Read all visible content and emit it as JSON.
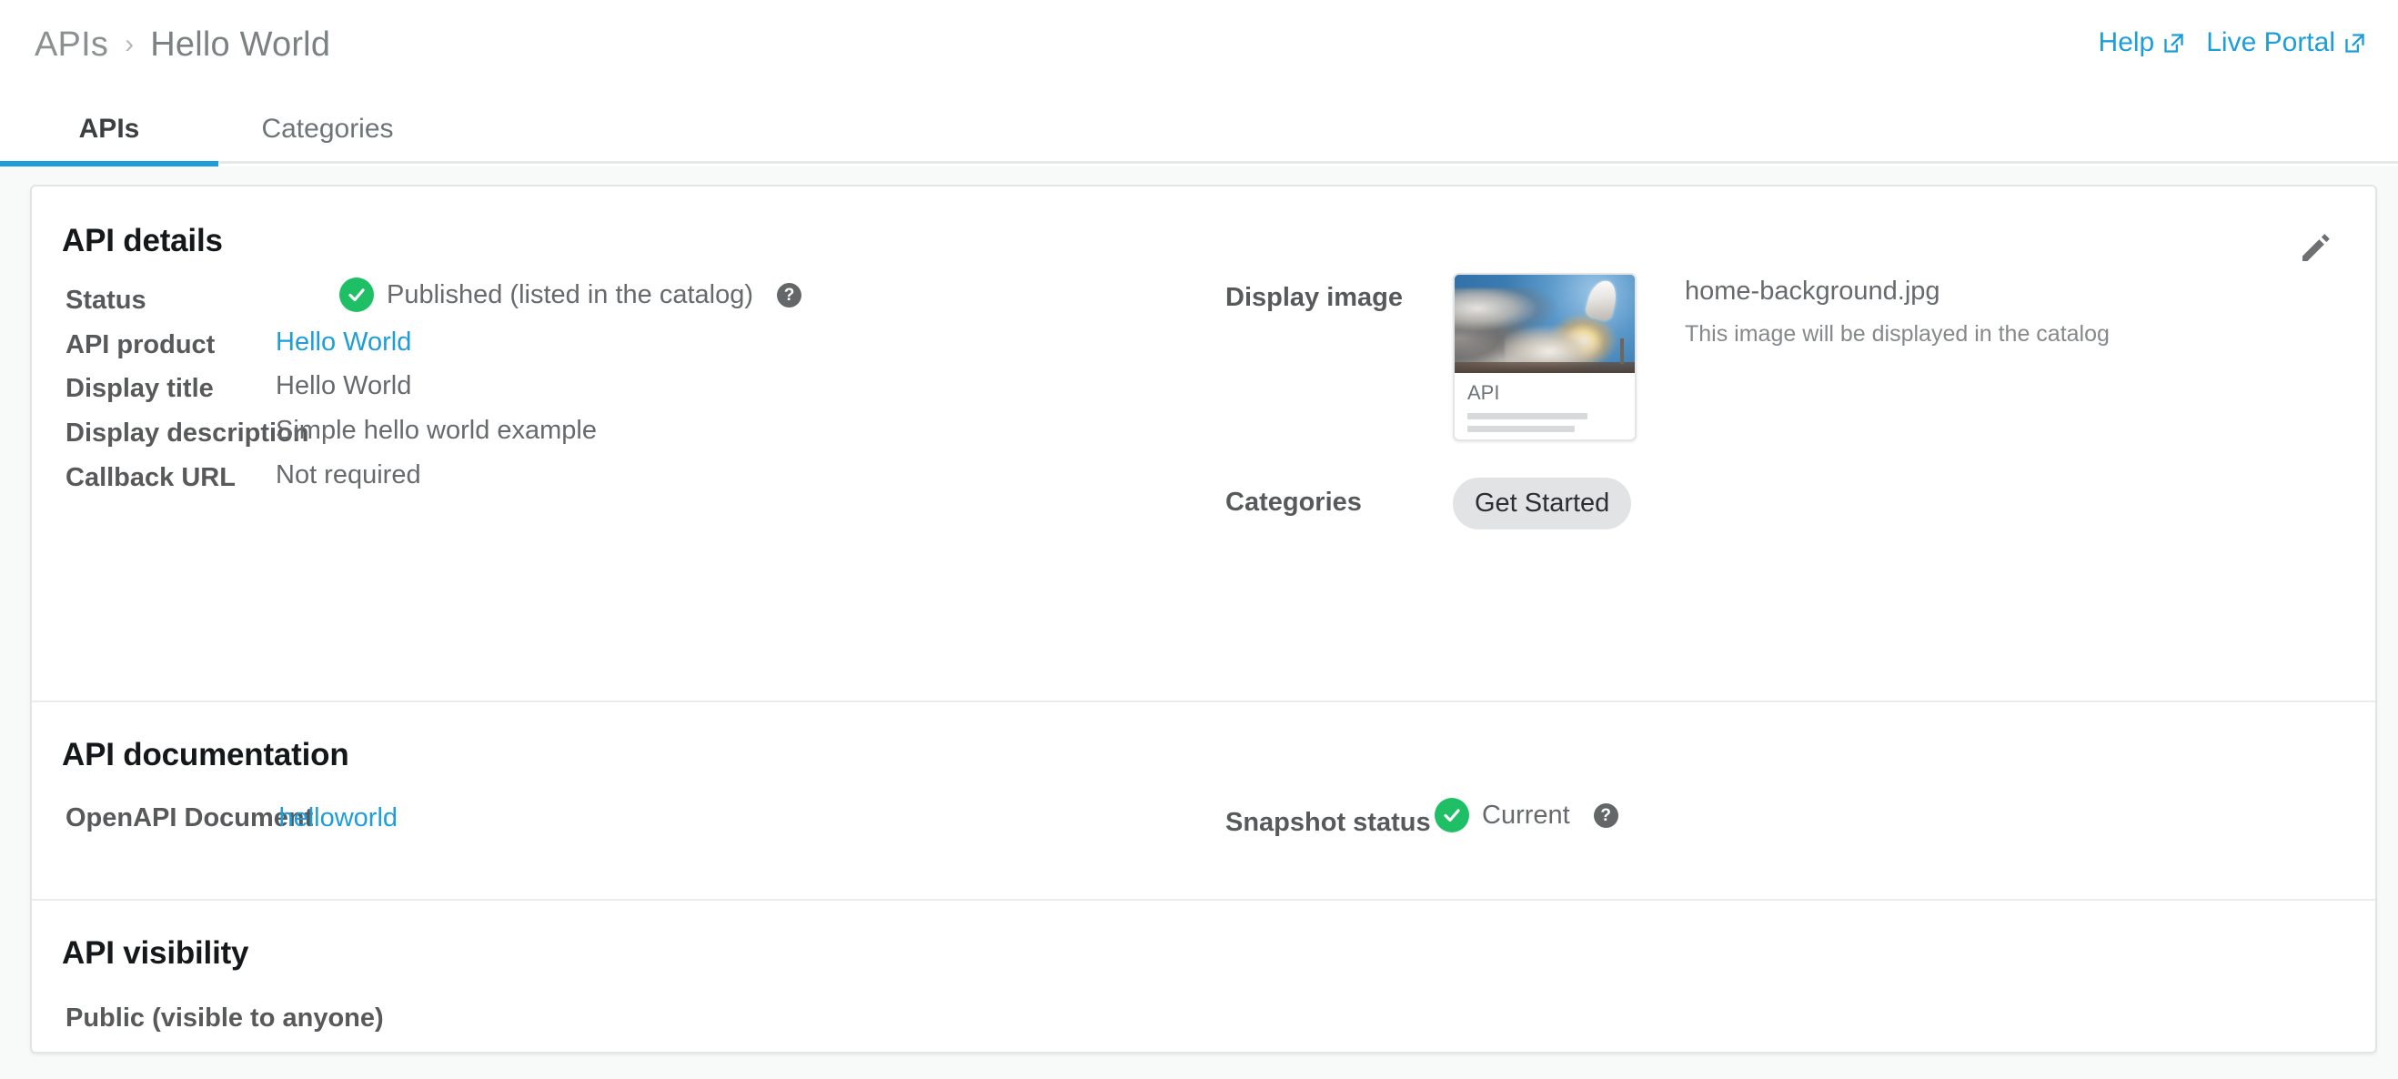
{
  "header": {
    "breadcrumb": {
      "root": "APIs",
      "separator": "›",
      "current": "Hello World"
    },
    "links": [
      {
        "label": "Help",
        "icon": "external-link-icon"
      },
      {
        "label": "Live Portal",
        "icon": "external-link-icon"
      }
    ]
  },
  "tabs": [
    {
      "label": "APIs",
      "active": true
    },
    {
      "label": "Categories",
      "active": false
    }
  ],
  "api_details": {
    "title": "API details",
    "edit_icon": "pencil-icon",
    "status": {
      "label": "Status",
      "value": "Published (listed in the catalog)",
      "icon": "check-circle-icon",
      "help_icon": "question-mark-icon",
      "help_glyph": "?"
    },
    "api_product": {
      "label": "API product",
      "value": "Hello World"
    },
    "display_title": {
      "label": "Display title",
      "value": "Hello World"
    },
    "display_description": {
      "label": "Display description",
      "value": "Simple hello world example"
    },
    "callback_url": {
      "label": "Callback URL",
      "value": "Not required"
    },
    "display_image": {
      "label": "Display image",
      "file_name": "home-background.jpg",
      "hint": "This image will be displayed in the catalog",
      "thumbnail_title": "API",
      "thumbnail_alt": "rocket-launch-photo"
    },
    "categories": {
      "label": "Categories",
      "chips": [
        "Get Started"
      ]
    }
  },
  "api_documentation": {
    "title": "API documentation",
    "openapi_document": {
      "label": "OpenAPI Document",
      "value": "helloworld"
    },
    "snapshot_status": {
      "label": "Snapshot status",
      "value": "Current",
      "icon": "check-circle-icon",
      "help_glyph": "?"
    }
  },
  "api_visibility": {
    "title": "API visibility",
    "value": "Public (visible to anyone)"
  },
  "colors": {
    "accent": "#1d9ed9",
    "success": "#1fc065",
    "page_bg": "#f8fafa",
    "card_border": "#e2e4e5",
    "label": "#57595b",
    "value": "#666a6c"
  }
}
